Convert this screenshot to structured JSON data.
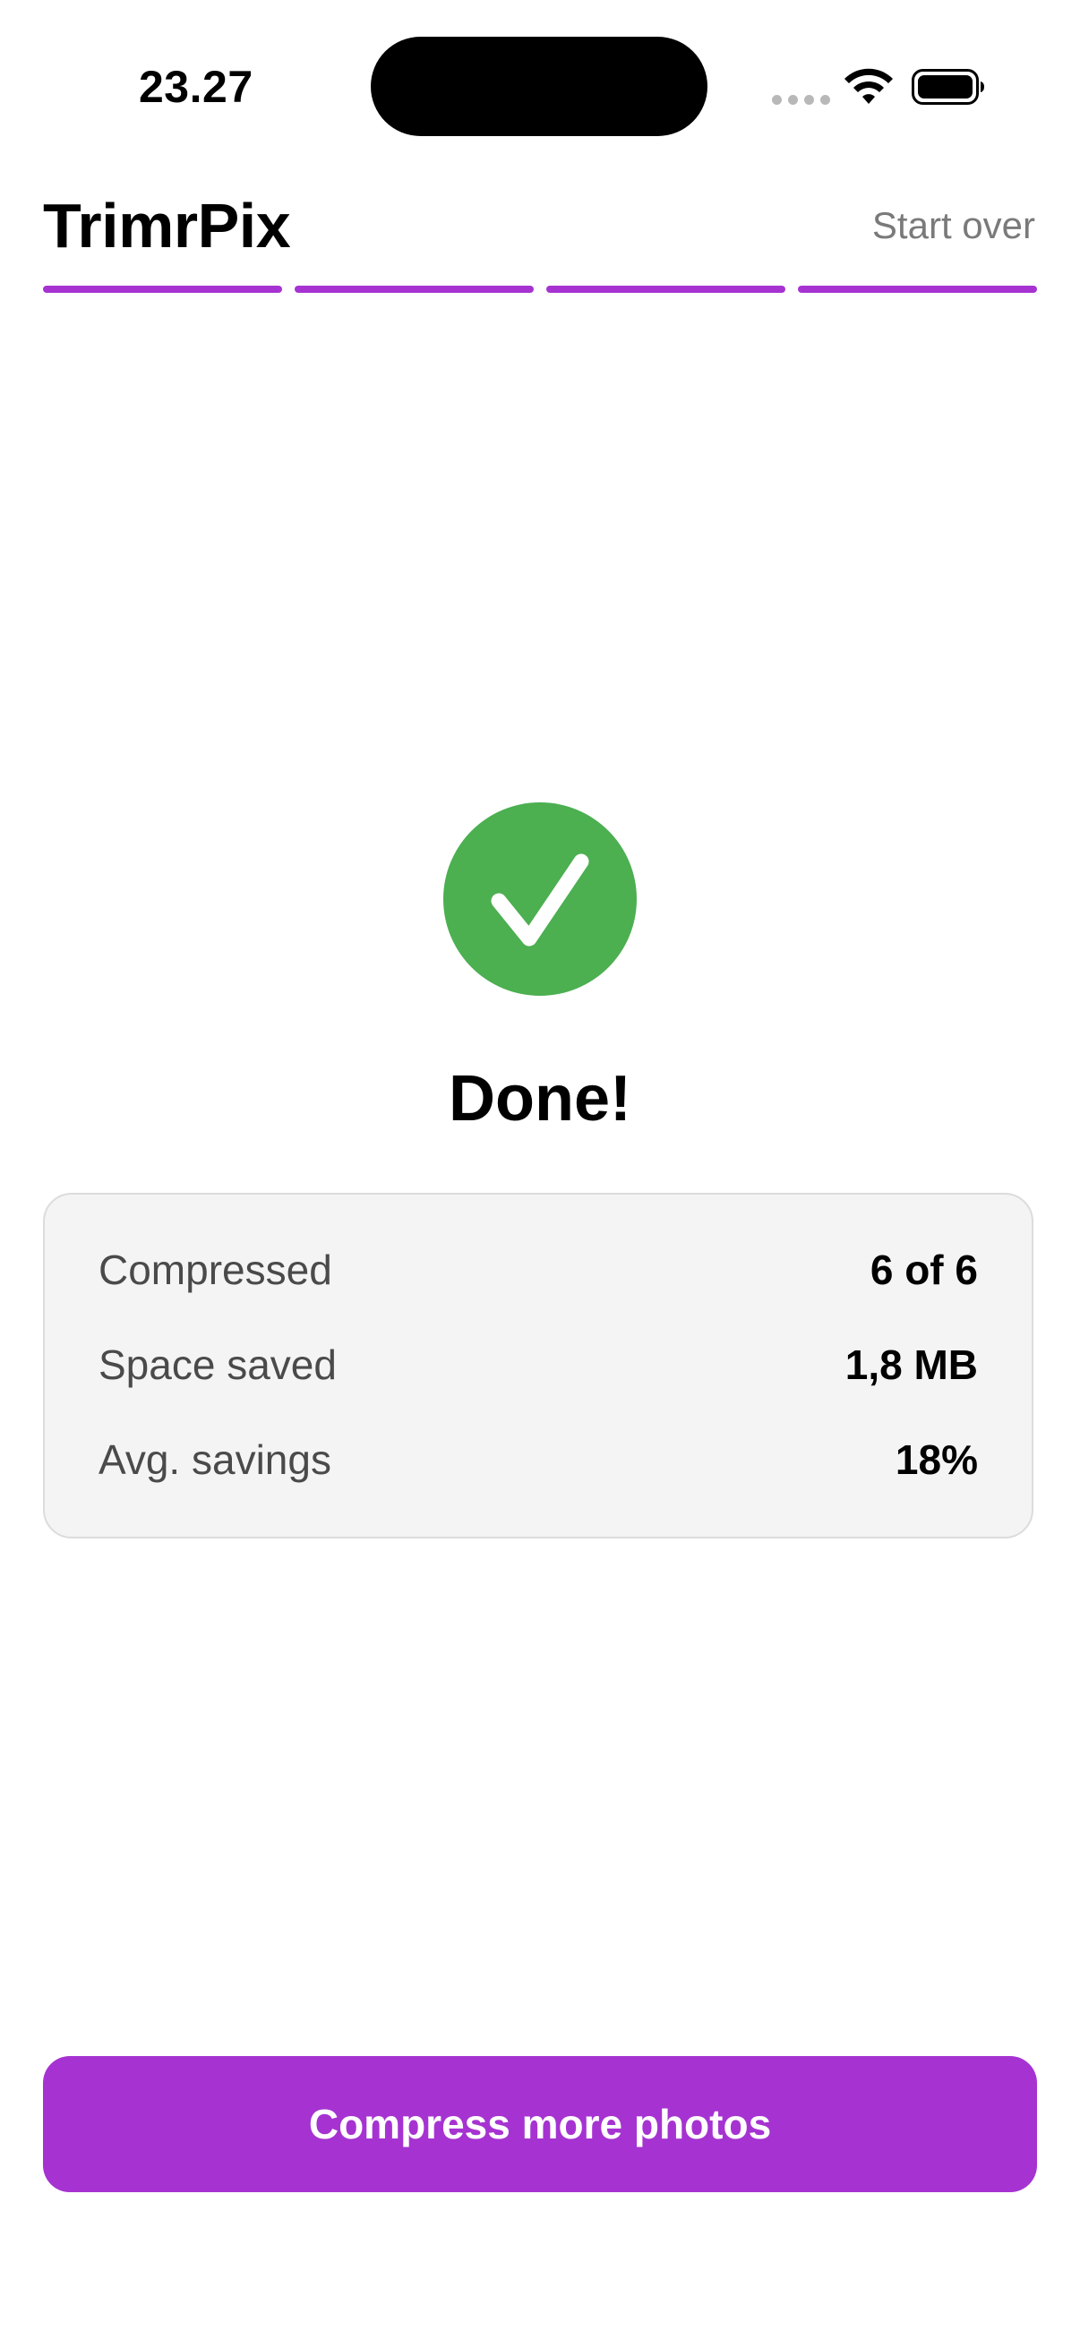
{
  "status_bar": {
    "time": "23.27",
    "signal_icon": "signal-dots-icon",
    "wifi_icon": "wifi-icon",
    "battery_icon": "battery-icon"
  },
  "header": {
    "title": "TrimrPix",
    "start_over_label": "Start over",
    "progress": {
      "total_steps": 4,
      "completed_steps": 4,
      "color": "#a633d1"
    }
  },
  "result": {
    "icon": "checkmark-icon",
    "icon_color": "#4caf50",
    "title": "Done!"
  },
  "stats": [
    {
      "label": "Compressed",
      "value": "6 of 6"
    },
    {
      "label": "Space saved",
      "value": "1,8 MB"
    },
    {
      "label": "Avg. savings",
      "value": "18%"
    }
  ],
  "footer": {
    "button_label": "Compress more photos",
    "button_color": "#a633d1"
  }
}
